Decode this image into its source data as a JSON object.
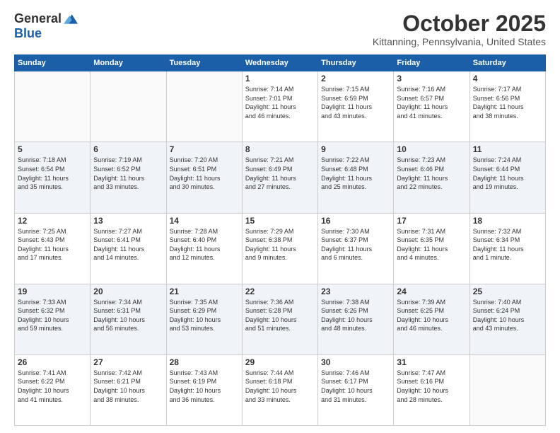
{
  "logo": {
    "general": "General",
    "blue": "Blue"
  },
  "header": {
    "month": "October 2025",
    "location": "Kittanning, Pennsylvania, United States"
  },
  "days_of_week": [
    "Sunday",
    "Monday",
    "Tuesday",
    "Wednesday",
    "Thursday",
    "Friday",
    "Saturday"
  ],
  "weeks": [
    [
      {
        "day": "",
        "info": ""
      },
      {
        "day": "",
        "info": ""
      },
      {
        "day": "",
        "info": ""
      },
      {
        "day": "1",
        "info": "Sunrise: 7:14 AM\nSunset: 7:01 PM\nDaylight: 11 hours\nand 46 minutes."
      },
      {
        "day": "2",
        "info": "Sunrise: 7:15 AM\nSunset: 6:59 PM\nDaylight: 11 hours\nand 43 minutes."
      },
      {
        "day": "3",
        "info": "Sunrise: 7:16 AM\nSunset: 6:57 PM\nDaylight: 11 hours\nand 41 minutes."
      },
      {
        "day": "4",
        "info": "Sunrise: 7:17 AM\nSunset: 6:56 PM\nDaylight: 11 hours\nand 38 minutes."
      }
    ],
    [
      {
        "day": "5",
        "info": "Sunrise: 7:18 AM\nSunset: 6:54 PM\nDaylight: 11 hours\nand 35 minutes."
      },
      {
        "day": "6",
        "info": "Sunrise: 7:19 AM\nSunset: 6:52 PM\nDaylight: 11 hours\nand 33 minutes."
      },
      {
        "day": "7",
        "info": "Sunrise: 7:20 AM\nSunset: 6:51 PM\nDaylight: 11 hours\nand 30 minutes."
      },
      {
        "day": "8",
        "info": "Sunrise: 7:21 AM\nSunset: 6:49 PM\nDaylight: 11 hours\nand 27 minutes."
      },
      {
        "day": "9",
        "info": "Sunrise: 7:22 AM\nSunset: 6:48 PM\nDaylight: 11 hours\nand 25 minutes."
      },
      {
        "day": "10",
        "info": "Sunrise: 7:23 AM\nSunset: 6:46 PM\nDaylight: 11 hours\nand 22 minutes."
      },
      {
        "day": "11",
        "info": "Sunrise: 7:24 AM\nSunset: 6:44 PM\nDaylight: 11 hours\nand 19 minutes."
      }
    ],
    [
      {
        "day": "12",
        "info": "Sunrise: 7:25 AM\nSunset: 6:43 PM\nDaylight: 11 hours\nand 17 minutes."
      },
      {
        "day": "13",
        "info": "Sunrise: 7:27 AM\nSunset: 6:41 PM\nDaylight: 11 hours\nand 14 minutes."
      },
      {
        "day": "14",
        "info": "Sunrise: 7:28 AM\nSunset: 6:40 PM\nDaylight: 11 hours\nand 12 minutes."
      },
      {
        "day": "15",
        "info": "Sunrise: 7:29 AM\nSunset: 6:38 PM\nDaylight: 11 hours\nand 9 minutes."
      },
      {
        "day": "16",
        "info": "Sunrise: 7:30 AM\nSunset: 6:37 PM\nDaylight: 11 hours\nand 6 minutes."
      },
      {
        "day": "17",
        "info": "Sunrise: 7:31 AM\nSunset: 6:35 PM\nDaylight: 11 hours\nand 4 minutes."
      },
      {
        "day": "18",
        "info": "Sunrise: 7:32 AM\nSunset: 6:34 PM\nDaylight: 11 hours\nand 1 minute."
      }
    ],
    [
      {
        "day": "19",
        "info": "Sunrise: 7:33 AM\nSunset: 6:32 PM\nDaylight: 10 hours\nand 59 minutes."
      },
      {
        "day": "20",
        "info": "Sunrise: 7:34 AM\nSunset: 6:31 PM\nDaylight: 10 hours\nand 56 minutes."
      },
      {
        "day": "21",
        "info": "Sunrise: 7:35 AM\nSunset: 6:29 PM\nDaylight: 10 hours\nand 53 minutes."
      },
      {
        "day": "22",
        "info": "Sunrise: 7:36 AM\nSunset: 6:28 PM\nDaylight: 10 hours\nand 51 minutes."
      },
      {
        "day": "23",
        "info": "Sunrise: 7:38 AM\nSunset: 6:26 PM\nDaylight: 10 hours\nand 48 minutes."
      },
      {
        "day": "24",
        "info": "Sunrise: 7:39 AM\nSunset: 6:25 PM\nDaylight: 10 hours\nand 46 minutes."
      },
      {
        "day": "25",
        "info": "Sunrise: 7:40 AM\nSunset: 6:24 PM\nDaylight: 10 hours\nand 43 minutes."
      }
    ],
    [
      {
        "day": "26",
        "info": "Sunrise: 7:41 AM\nSunset: 6:22 PM\nDaylight: 10 hours\nand 41 minutes."
      },
      {
        "day": "27",
        "info": "Sunrise: 7:42 AM\nSunset: 6:21 PM\nDaylight: 10 hours\nand 38 minutes."
      },
      {
        "day": "28",
        "info": "Sunrise: 7:43 AM\nSunset: 6:19 PM\nDaylight: 10 hours\nand 36 minutes."
      },
      {
        "day": "29",
        "info": "Sunrise: 7:44 AM\nSunset: 6:18 PM\nDaylight: 10 hours\nand 33 minutes."
      },
      {
        "day": "30",
        "info": "Sunrise: 7:46 AM\nSunset: 6:17 PM\nDaylight: 10 hours\nand 31 minutes."
      },
      {
        "day": "31",
        "info": "Sunrise: 7:47 AM\nSunset: 6:16 PM\nDaylight: 10 hours\nand 28 minutes."
      },
      {
        "day": "",
        "info": ""
      }
    ]
  ]
}
